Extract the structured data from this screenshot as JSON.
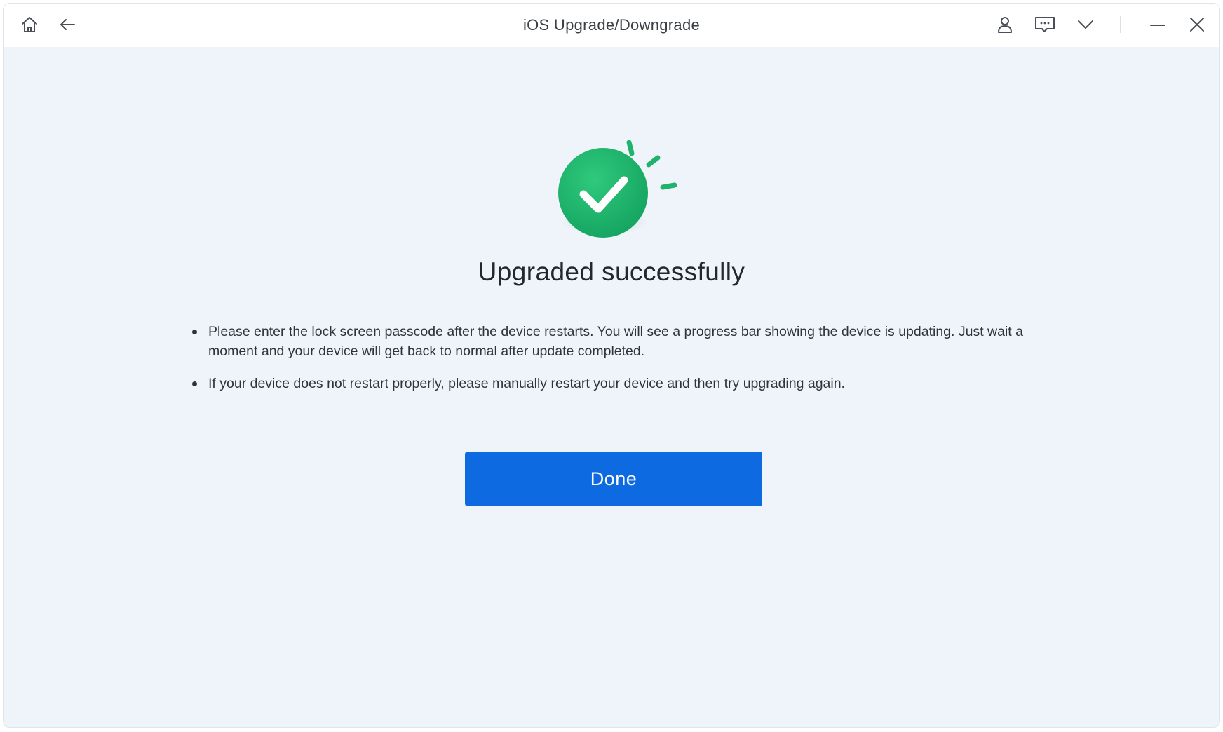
{
  "window": {
    "title": "iOS Upgrade/Downgrade"
  },
  "titlebar": {
    "left_icons": [
      "home-icon",
      "back-arrow-icon"
    ],
    "right_icons": [
      "user-icon",
      "feedback-icon",
      "chevron-down-icon",
      "minimize-icon",
      "close-icon"
    ]
  },
  "result": {
    "icon": "check-circle-icon",
    "headline": "Upgraded successfully",
    "notes": [
      "Please enter the lock screen passcode after the device restarts. You will see a progress bar showing the device is updating. Just wait a moment and your device will get back to normal after update completed.",
      "If your device does not restart properly, please manually restart your device and then try upgrading again."
    ]
  },
  "actions": {
    "done_label": "Done"
  },
  "colors": {
    "background": "#eff4fa",
    "titlebar": "#ffffff",
    "success_green": "#1fb36c",
    "primary_button": "#0e6ae0",
    "text_dark": "#23272e"
  }
}
